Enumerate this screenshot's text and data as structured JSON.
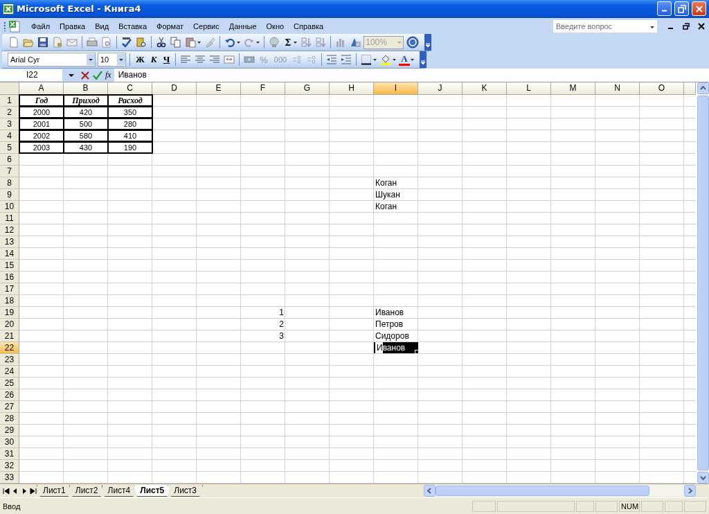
{
  "window": {
    "title": "Microsoft Excel - Книга4"
  },
  "menu": [
    "Файл",
    "Правка",
    "Вид",
    "Вставка",
    "Формат",
    "Сервис",
    "Данные",
    "Окно",
    "Справка"
  ],
  "help_box": {
    "placeholder": "Введите вопрос"
  },
  "standard_toolbar": {
    "sum": "Σ",
    "zoom": "100%"
  },
  "formatting_toolbar": {
    "font": "Arial Cyr",
    "size": "10",
    "bold": "Ж",
    "italic": "К",
    "underline": "Ч",
    "percent": "%",
    "thousands": "000",
    "font_color": "A"
  },
  "formula_bar": {
    "name_box": "I22",
    "fx": "fx",
    "content": "Иванов"
  },
  "columns": [
    {
      "label": "A",
      "selected": false
    },
    {
      "label": "B",
      "selected": false
    },
    {
      "label": "C",
      "selected": false
    },
    {
      "label": "D",
      "selected": false
    },
    {
      "label": "E",
      "selected": false
    },
    {
      "label": "F",
      "selected": false
    },
    {
      "label": "G",
      "selected": false
    },
    {
      "label": "H",
      "selected": false
    },
    {
      "label": "I",
      "selected": true
    },
    {
      "label": "J",
      "selected": false
    },
    {
      "label": "K",
      "selected": false
    },
    {
      "label": "L",
      "selected": false
    },
    {
      "label": "M",
      "selected": false
    },
    {
      "label": "N",
      "selected": false
    },
    {
      "label": "O",
      "selected": false
    }
  ],
  "rows": [
    {
      "number": "1",
      "selected": false,
      "cells": {
        "A": {
          "kind": "table-head",
          "text": "Год"
        },
        "B": {
          "kind": "table-head",
          "text": "Приход"
        },
        "C": {
          "kind": "table-head",
          "text": "Расход"
        }
      }
    },
    {
      "number": "2",
      "selected": false,
      "cells": {
        "A": {
          "kind": "table-value",
          "text": "2000"
        },
        "B": {
          "kind": "table-value",
          "text": "420"
        },
        "C": {
          "kind": "table-value",
          "text": "350"
        }
      }
    },
    {
      "number": "3",
      "selected": false,
      "cells": {
        "A": {
          "kind": "table-value",
          "text": "2001"
        },
        "B": {
          "kind": "table-value",
          "text": "500"
        },
        "C": {
          "kind": "table-value",
          "text": "280"
        }
      }
    },
    {
      "number": "4",
      "selected": false,
      "cells": {
        "A": {
          "kind": "table-value",
          "text": "2002"
        },
        "B": {
          "kind": "table-value",
          "text": "580"
        },
        "C": {
          "kind": "table-value",
          "text": "410"
        }
      }
    },
    {
      "number": "5",
      "selected": false,
      "cells": {
        "A": {
          "kind": "table-value",
          "text": "2003"
        },
        "B": {
          "kind": "table-value",
          "text": "430"
        },
        "C": {
          "kind": "table-value",
          "text": "190"
        }
      }
    },
    {
      "number": "6",
      "selected": false
    },
    {
      "number": "7",
      "selected": false
    },
    {
      "number": "8",
      "selected": false,
      "cells": {
        "I": {
          "kind": "text",
          "text": "Коган"
        }
      }
    },
    {
      "number": "9",
      "selected": false,
      "cells": {
        "I": {
          "kind": "text",
          "text": "Шукан"
        }
      }
    },
    {
      "number": "10",
      "selected": false,
      "cells": {
        "I": {
          "kind": "text",
          "text": "Коган"
        }
      }
    },
    {
      "number": "11",
      "selected": false
    },
    {
      "number": "12",
      "selected": false
    },
    {
      "number": "13",
      "selected": false
    },
    {
      "number": "14",
      "selected": false
    },
    {
      "number": "15",
      "selected": false
    },
    {
      "number": "16",
      "selected": false
    },
    {
      "number": "17",
      "selected": false
    },
    {
      "number": "18",
      "selected": false
    },
    {
      "number": "19",
      "selected": false,
      "cells": {
        "F": {
          "kind": "number",
          "text": "1"
        },
        "I": {
          "kind": "text",
          "text": "Иванов"
        }
      }
    },
    {
      "number": "20",
      "selected": false,
      "cells": {
        "F": {
          "kind": "number",
          "text": "2"
        },
        "I": {
          "kind": "text",
          "text": "Петров"
        }
      }
    },
    {
      "number": "21",
      "selected": false,
      "cells": {
        "F": {
          "kind": "number",
          "text": "3"
        },
        "I": {
          "kind": "text",
          "text": "Сидоров"
        }
      }
    },
    {
      "number": "22",
      "selected": true,
      "cells": {
        "I": {
          "kind": "editing",
          "typed": "И",
          "completion": "ванов"
        }
      }
    },
    {
      "number": "23",
      "selected": false
    },
    {
      "number": "24",
      "selected": false
    },
    {
      "number": "25",
      "selected": false
    },
    {
      "number": "26",
      "selected": false
    },
    {
      "number": "27",
      "selected": false
    },
    {
      "number": "28",
      "selected": false
    },
    {
      "number": "29",
      "selected": false
    },
    {
      "number": "30",
      "selected": false
    },
    {
      "number": "31",
      "selected": false
    },
    {
      "number": "32",
      "selected": false
    },
    {
      "number": "33",
      "selected": false
    }
  ],
  "sheet_tabs": [
    {
      "label": "Лист1",
      "selected": false
    },
    {
      "label": "Лист2",
      "selected": false
    },
    {
      "label": "Лист4",
      "selected": false
    },
    {
      "label": "Лист5",
      "selected": true
    },
    {
      "label": "Лист3",
      "selected": false
    }
  ],
  "status_bar": {
    "mode": "Ввод",
    "num": "NUM"
  }
}
